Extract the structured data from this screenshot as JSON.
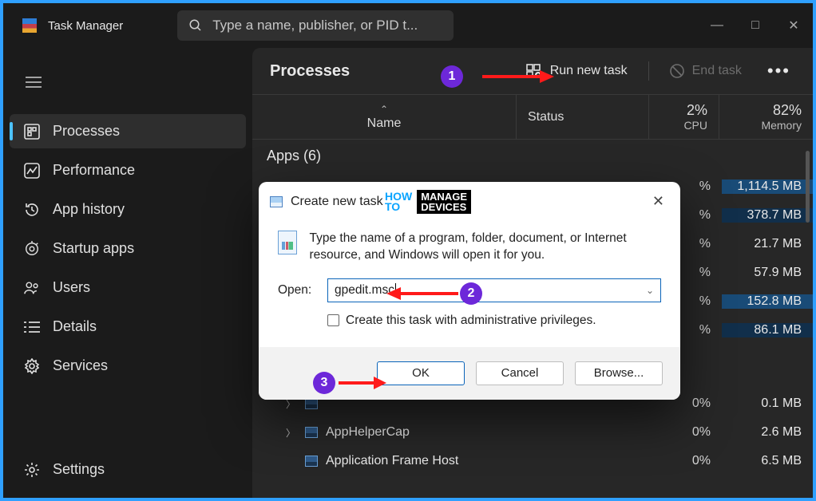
{
  "app": {
    "title": "Task Manager"
  },
  "search": {
    "placeholder": "Type a name, publisher, or PID t..."
  },
  "window_controls": {
    "minimize": "—",
    "maximize": "□",
    "close": "✕"
  },
  "sidebar": {
    "items": [
      {
        "label": "Processes",
        "icon": "processes-icon",
        "active": true
      },
      {
        "label": "Performance",
        "icon": "performance-icon",
        "active": false
      },
      {
        "label": "App history",
        "icon": "history-icon",
        "active": false
      },
      {
        "label": "Startup apps",
        "icon": "startup-icon",
        "active": false
      },
      {
        "label": "Users",
        "icon": "users-icon",
        "active": false
      },
      {
        "label": "Details",
        "icon": "details-icon",
        "active": false
      },
      {
        "label": "Services",
        "icon": "services-icon",
        "active": false
      }
    ],
    "footer": {
      "label": "Settings",
      "icon": "settings-icon"
    }
  },
  "content": {
    "title": "Processes",
    "run_new_task": "Run new task",
    "end_task": "End task"
  },
  "columns": {
    "name": "Name",
    "status": "Status",
    "cpu_pct": "2%",
    "cpu_label": "CPU",
    "mem_pct": "82%",
    "mem_label": "Memory"
  },
  "group": {
    "label": "Apps (6)"
  },
  "rows": [
    {
      "name": "",
      "cpu": "%",
      "mem": "1,114.5 MB",
      "mem_class": "hl1",
      "expandable": true
    },
    {
      "name": "",
      "cpu": "%",
      "mem": "378.7 MB",
      "mem_class": "hl2",
      "expandable": true
    },
    {
      "name": "",
      "cpu": "%",
      "mem": "21.7 MB",
      "mem_class": "",
      "expandable": true
    },
    {
      "name": "",
      "cpu": "%",
      "mem": "57.9 MB",
      "mem_class": "",
      "expandable": true
    },
    {
      "name": "",
      "cpu": "%",
      "mem": "152.8 MB",
      "mem_class": "hl1",
      "expandable": true
    },
    {
      "name": "",
      "cpu": "%",
      "mem": "86.1 MB",
      "mem_class": "hl2",
      "expandable": true
    }
  ],
  "rows_bottom": [
    {
      "name": "",
      "cpu": "0%",
      "mem": "0.1 MB",
      "expandable": true
    },
    {
      "name": "AppHelperCap",
      "cpu": "0%",
      "mem": "2.6 MB",
      "expandable": true
    },
    {
      "name": "Application Frame Host",
      "cpu": "0%",
      "mem": "6.5 MB",
      "expandable": false
    }
  ],
  "dialog": {
    "title": "Create new task",
    "description": "Type the name of a program, folder, document, or Internet resource, and Windows will open it for you.",
    "open_label": "Open:",
    "open_value": "gpedit.msc",
    "admin_checkbox": "Create this task with administrative privileges.",
    "buttons": {
      "ok": "OK",
      "cancel": "Cancel",
      "browse": "Browse..."
    }
  },
  "callouts": {
    "one": "1",
    "two": "2",
    "three": "3"
  },
  "watermark": {
    "a1": "HOW",
    "a2": "TO",
    "b1": "MANAGE",
    "b2": "DEVICES"
  }
}
